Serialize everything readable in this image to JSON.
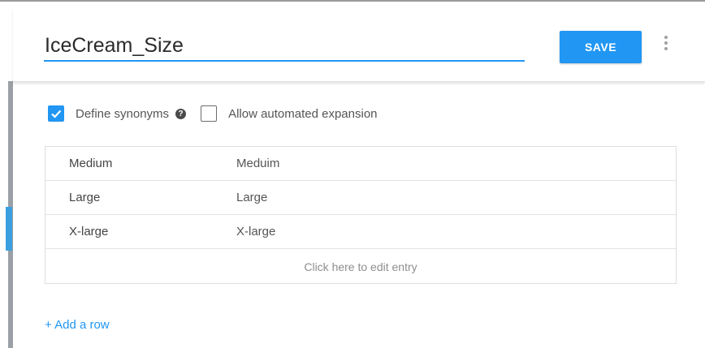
{
  "entity": {
    "name": "IceCream_Size"
  },
  "toolbar": {
    "save_label": "SAVE",
    "more_icon": "more-vertical-icon"
  },
  "options": {
    "define_synonyms": {
      "label": "Define synonyms",
      "checked": true
    },
    "help_icon": "help-icon",
    "allow_automated_expansion": {
      "label": "Allow automated expansion",
      "checked": false
    }
  },
  "entries": [
    {
      "value": "Medium",
      "synonym": "Meduim"
    },
    {
      "value": "Large",
      "synonym": "Large"
    },
    {
      "value": "X-large",
      "synonym": "X-large"
    }
  ],
  "edit_entry_label": "Click here to edit entry",
  "add_row_label": "+ Add a row",
  "colors": {
    "accent": "#2196f3",
    "scroll_thumb": "#3aa0e0"
  }
}
